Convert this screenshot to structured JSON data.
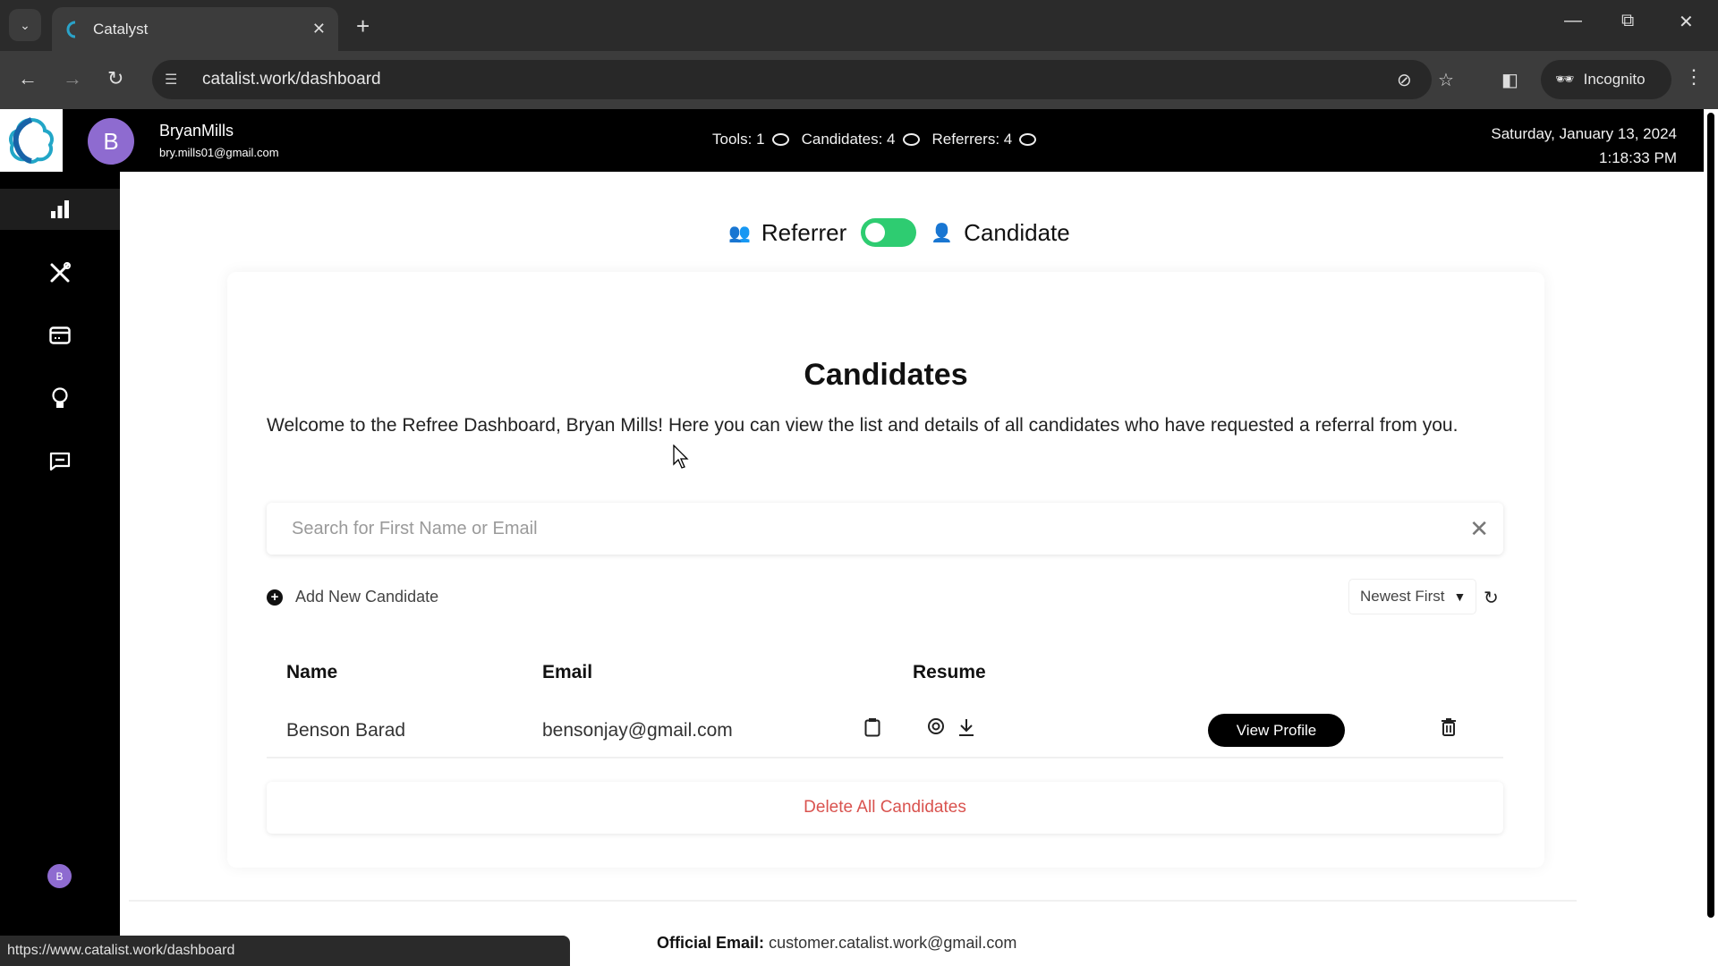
{
  "browser": {
    "tab_title": "Catalyst",
    "url": "catalist.work/dashboard",
    "incognito_label": "Incognito",
    "status_url": "https://www.catalist.work/dashboard"
  },
  "header": {
    "avatar_letter": "B",
    "user_name": "BryanMills",
    "user_email": "bry.mills01@gmail.com",
    "stats": [
      {
        "label": "Tools: 1"
      },
      {
        "label": "Candidates: 4"
      },
      {
        "label": "Referrers: 4"
      }
    ],
    "date": "Saturday, January 13, 2024",
    "time": "1:18:33 PM"
  },
  "sidebar": {
    "items": [
      {
        "icon": "bar-chart-icon",
        "active": true
      },
      {
        "icon": "tools-icon"
      },
      {
        "icon": "credit-card-icon"
      },
      {
        "icon": "lightbulb-icon"
      },
      {
        "icon": "message-icon"
      }
    ],
    "avatar_letter": "B"
  },
  "toggle": {
    "left_label": "Referrer",
    "right_label": "Candidate",
    "state": "candidate",
    "color": "#2ecc71"
  },
  "main": {
    "title": "Candidates",
    "intro": "Welcome to the Refree Dashboard, Bryan Mills! Here you can view the list and details of all candidates who have requested a referral from you.",
    "search_placeholder": "Search for First Name or Email",
    "search_value": "",
    "add_label": "Add New Candidate",
    "sort_selected": "Newest First",
    "table": {
      "headers": [
        "Name",
        "Email",
        "Resume"
      ],
      "rows": [
        {
          "name": "Benson Barad",
          "email": "bensonjay@gmail.com",
          "action_label": "View Profile"
        }
      ]
    },
    "delete_all_label": "Delete All Candidates",
    "delete_color": "#d9534f"
  },
  "footer": {
    "official_label": "Official Email:",
    "official_email": "customer.catalist.work@gmail.com"
  }
}
